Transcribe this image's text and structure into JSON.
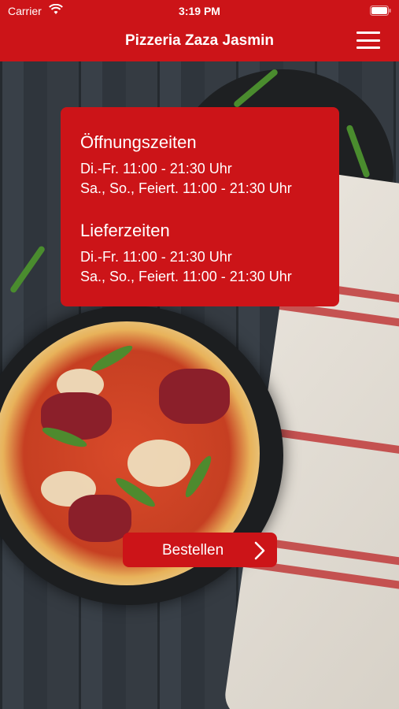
{
  "status_bar": {
    "carrier": "Carrier",
    "time": "3:19 PM"
  },
  "nav": {
    "title": "Pizzeria Zaza Jasmin",
    "menu_icon": "hamburger-menu-icon"
  },
  "hours": {
    "opening_title": "Öffnungszeiten",
    "opening_lines": [
      "Di.-Fr. 11:00 - 21:30 Uhr",
      "Sa., So., Feiert. 11:00 - 21:30 Uhr"
    ],
    "delivery_title": "Lieferzeiten",
    "delivery_lines": [
      "Di.-Fr. 11:00 - 21:30 Uhr",
      "Sa., So., Feiert. 11:00 - 21:30 Uhr"
    ]
  },
  "order_button": {
    "label": "Bestellen",
    "icon": "chevron-right-icon"
  },
  "colors": {
    "brand_red": "#cc1418",
    "text_on_brand": "#ffffff"
  }
}
